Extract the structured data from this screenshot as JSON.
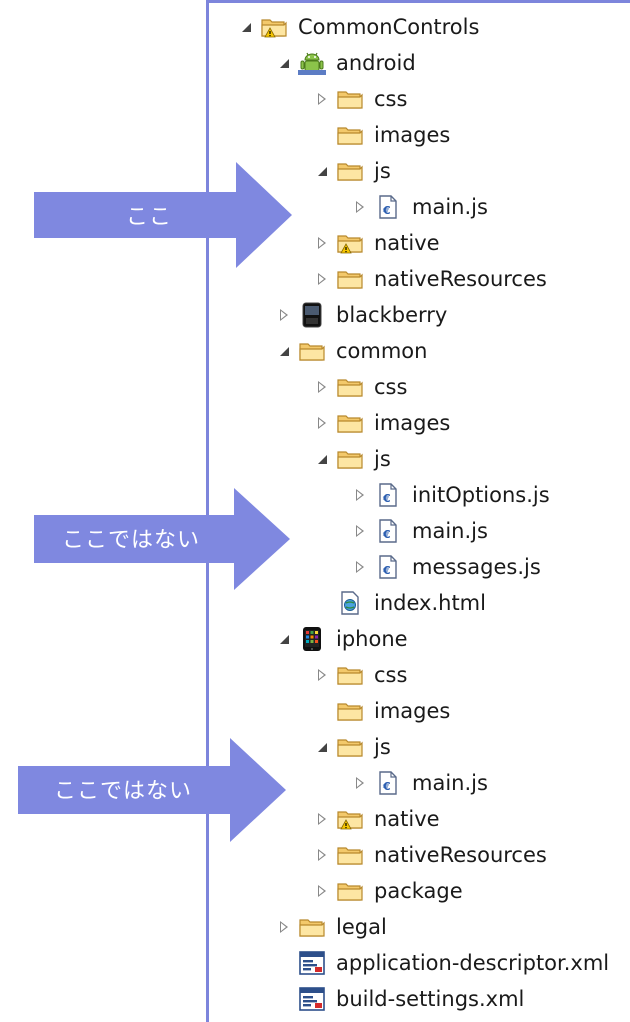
{
  "tree": [
    {
      "label": "CommonControls",
      "indent": 0,
      "toggle": "open",
      "icon": "project-folder-icon"
    },
    {
      "label": "android",
      "indent": 1,
      "toggle": "open",
      "icon": "android-icon"
    },
    {
      "label": "css",
      "indent": 2,
      "toggle": "closed",
      "icon": "folder-icon"
    },
    {
      "label": "images",
      "indent": 2,
      "toggle": "none",
      "icon": "folder-icon"
    },
    {
      "label": "js",
      "indent": 2,
      "toggle": "open",
      "icon": "folder-icon"
    },
    {
      "label": "main.js",
      "indent": 3,
      "toggle": "closed",
      "icon": "js-file-icon"
    },
    {
      "label": "native",
      "indent": 2,
      "toggle": "closed",
      "icon": "warning-folder-icon"
    },
    {
      "label": "nativeResources",
      "indent": 2,
      "toggle": "closed",
      "icon": "folder-icon"
    },
    {
      "label": "blackberry",
      "indent": 1,
      "toggle": "closed",
      "icon": "blackberry-icon"
    },
    {
      "label": "common",
      "indent": 1,
      "toggle": "open",
      "icon": "folder-icon"
    },
    {
      "label": "css",
      "indent": 2,
      "toggle": "closed",
      "icon": "folder-icon"
    },
    {
      "label": "images",
      "indent": 2,
      "toggle": "closed",
      "icon": "folder-icon"
    },
    {
      "label": "js",
      "indent": 2,
      "toggle": "open",
      "icon": "folder-icon"
    },
    {
      "label": "initOptions.js",
      "indent": 3,
      "toggle": "closed",
      "icon": "js-file-icon"
    },
    {
      "label": "main.js",
      "indent": 3,
      "toggle": "closed",
      "icon": "js-file-icon"
    },
    {
      "label": "messages.js",
      "indent": 3,
      "toggle": "closed",
      "icon": "js-file-icon"
    },
    {
      "label": "index.html",
      "indent": 2,
      "toggle": "none",
      "icon": "html-file-icon"
    },
    {
      "label": "iphone",
      "indent": 1,
      "toggle": "open",
      "icon": "iphone-icon"
    },
    {
      "label": "css",
      "indent": 2,
      "toggle": "closed",
      "icon": "folder-icon"
    },
    {
      "label": "images",
      "indent": 2,
      "toggle": "none",
      "icon": "folder-icon"
    },
    {
      "label": "js",
      "indent": 2,
      "toggle": "open",
      "icon": "folder-icon"
    },
    {
      "label": "main.js",
      "indent": 3,
      "toggle": "closed",
      "icon": "js-file-icon"
    },
    {
      "label": "native",
      "indent": 2,
      "toggle": "closed",
      "icon": "warning-folder-icon"
    },
    {
      "label": "nativeResources",
      "indent": 2,
      "toggle": "closed",
      "icon": "folder-icon"
    },
    {
      "label": "package",
      "indent": 2,
      "toggle": "closed",
      "icon": "folder-icon"
    },
    {
      "label": "legal",
      "indent": 1,
      "toggle": "closed",
      "icon": "folder-icon"
    },
    {
      "label": "application-descriptor.xml",
      "indent": 1,
      "toggle": "none",
      "icon": "xml-file-icon"
    },
    {
      "label": "build-settings.xml",
      "indent": 1,
      "toggle": "none",
      "icon": "xml-file-icon"
    }
  ],
  "callouts": [
    {
      "text": "ここ"
    },
    {
      "text": "ここではない"
    },
    {
      "text": "ここではない"
    }
  ],
  "colors": {
    "panel_border": "#7d85dc",
    "callout_fill": "#7f88e0",
    "folder": "#f3c96b"
  }
}
